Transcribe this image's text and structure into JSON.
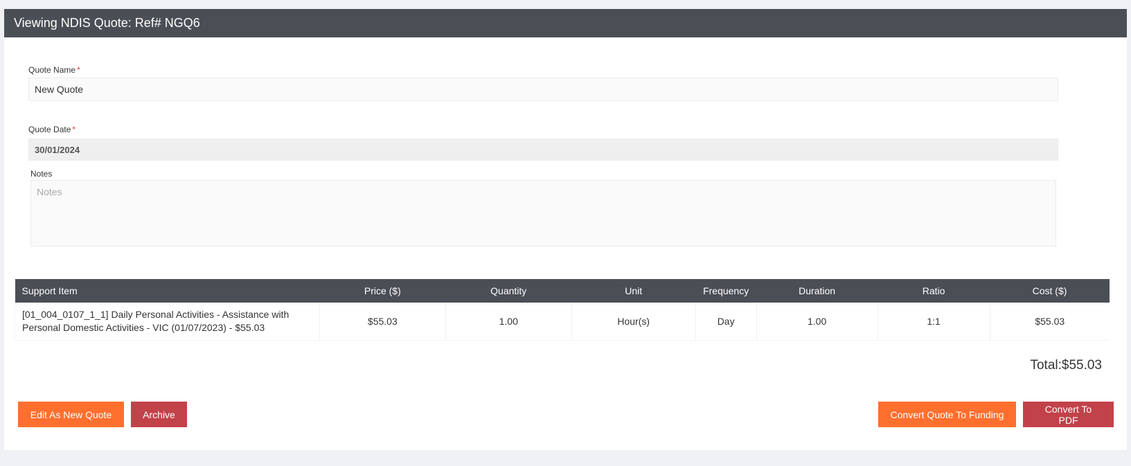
{
  "header": {
    "title": "Viewing NDIS Quote: Ref# NGQ6"
  },
  "form": {
    "quote_name": {
      "label": "Quote Name",
      "required_mark": "*",
      "value": "New Quote"
    },
    "quote_date": {
      "label": "Quote Date",
      "required_mark": "*",
      "value": "30/01/2024"
    },
    "notes": {
      "label": "Notes",
      "placeholder": "Notes"
    }
  },
  "table": {
    "headers": [
      "Support Item",
      "Price ($)",
      "Quantity",
      "Unit",
      "Frequency",
      "Duration",
      "Ratio",
      "Cost ($)"
    ],
    "rows": [
      {
        "support_item": "[01_004_0107_1_1] Daily Personal Activities - Assistance with Personal Domestic Activities - VIC (01/07/2023) - $55.03",
        "price": "$55.03",
        "quantity": "1.00",
        "unit": "Hour(s)",
        "frequency": "Day",
        "duration": "1.00",
        "ratio": "1:1",
        "cost": "$55.03"
      }
    ]
  },
  "total": {
    "text": "Total:$55.03"
  },
  "buttons": {
    "edit_as_new": "Edit As New Quote",
    "archive": "Archive",
    "convert_to_funding": "Convert Quote To Funding",
    "convert_to_pdf": "Convert To PDF"
  },
  "colors": {
    "header_bg": "#4a4e55",
    "orange_button": "#ff6f2e",
    "red_button": "#c2424a",
    "required": "#e53935"
  }
}
